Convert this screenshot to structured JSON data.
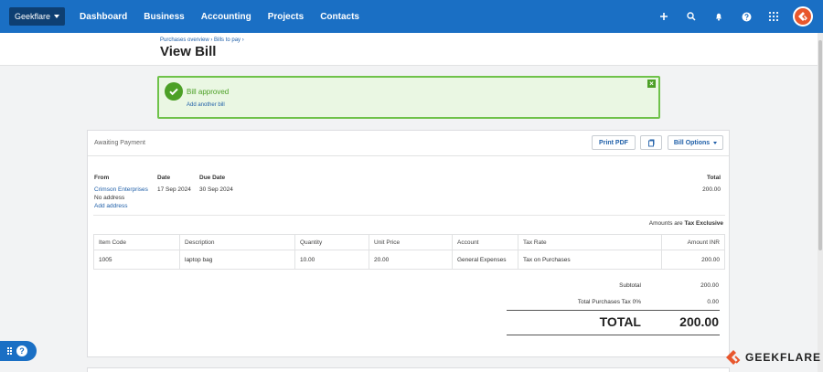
{
  "nav": {
    "org": "Geekflare",
    "links": [
      "Dashboard",
      "Business",
      "Accounting",
      "Projects",
      "Contacts"
    ],
    "icons": [
      "plus-icon",
      "search-icon",
      "bell-icon",
      "help-icon",
      "apps-grid-icon"
    ]
  },
  "header": {
    "breadcrumb_1": "Purchases overview",
    "breadcrumb_2": "Bills to pay",
    "sep": "›",
    "title": "View Bill"
  },
  "banner": {
    "message": "Bill approved",
    "link": "Add another bill"
  },
  "bill": {
    "status": "Awaiting Payment",
    "buttons": {
      "print": "Print PDF",
      "options": "Bill Options"
    },
    "labels": {
      "from": "From",
      "date": "Date",
      "due_date": "Due Date",
      "total": "Total"
    },
    "from": "Crimson Enterprises",
    "address": "No address",
    "add_address": "Add address",
    "date": "17 Sep 2024",
    "due_date": "30 Sep 2024",
    "total": "200.00",
    "amounts_are_label": "Amounts are",
    "amounts_are_value": "Tax Exclusive",
    "columns": [
      "Item Code",
      "Description",
      "Quantity",
      "Unit Price",
      "Account",
      "Tax Rate",
      "Amount INR"
    ],
    "rows": [
      [
        "1005",
        "laptop bag",
        "10.00",
        "20.00",
        "General Expenses",
        "Tax on Purchases",
        "200.00"
      ]
    ],
    "subtotal_label": "Subtotal",
    "subtotal": "200.00",
    "tax_label": "Total Purchases Tax 0%",
    "tax": "0.00",
    "grand_label": "TOTAL",
    "grand": "200.00"
  },
  "watermark": "GEEKFLARE",
  "colors": {
    "nav": "#1a6fc4",
    "org_button": "#0e3f72",
    "success": "#4ca026",
    "link": "#1f5fa8",
    "brand": "#e8572d"
  }
}
